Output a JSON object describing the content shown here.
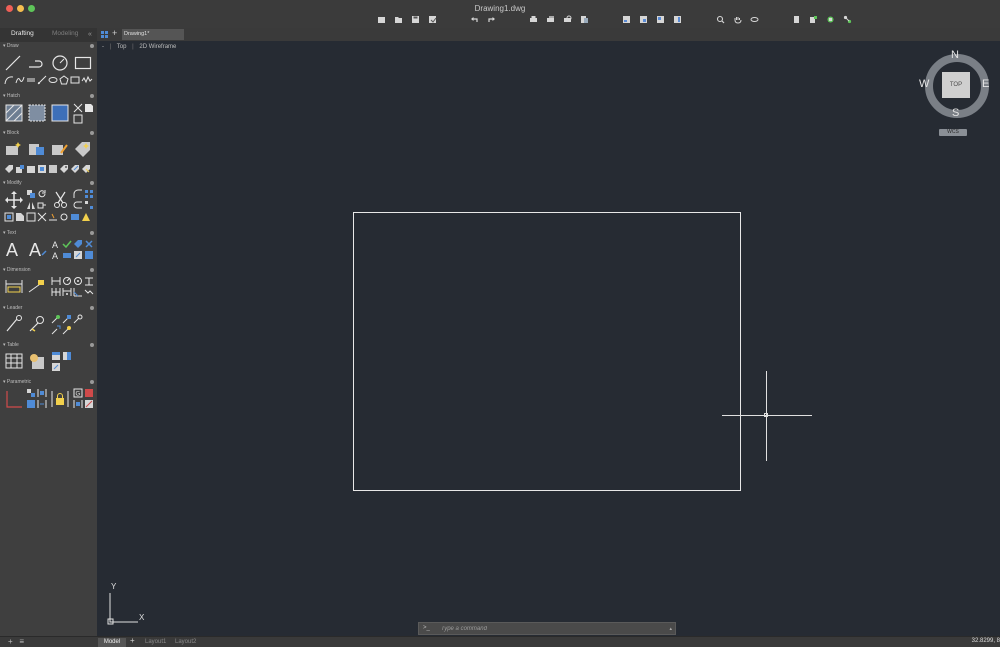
{
  "window": {
    "title": "Drawing1.dwg"
  },
  "toolbar": {
    "icons": [
      "new-icon",
      "open-icon",
      "save-icon",
      "save-as-icon",
      "undo-icon",
      "redo-icon",
      "plot-icon",
      "batch-plot-icon",
      "plot-preview-icon",
      "publish-icon",
      "sheet-icon",
      "layer-icon",
      "properties-icon",
      "layout-icon",
      "zoom-icon",
      "pan-icon",
      "orbit-icon",
      "file-icon",
      "attach-icon",
      "sync-icon",
      "share-icon"
    ]
  },
  "palette": {
    "tabs": {
      "drafting": "Drafting",
      "modeling": "Modeling"
    },
    "sections": {
      "draw": "Draw",
      "hatch": "Hatch",
      "block": "Block",
      "modify": "Modify",
      "text": "Text",
      "dimension": "Dimension",
      "leader": "Leader",
      "table": "Table",
      "parametric": "Parametric"
    }
  },
  "doc_tabs": {
    "active": "Drawing1*"
  },
  "viewport": {
    "controls": {
      "menu": "-",
      "view": "Top",
      "style": "2D Wireframe"
    },
    "navcube": {
      "n": "N",
      "s": "S",
      "e": "E",
      "w": "W",
      "face": "TOP",
      "wcs": "WCS"
    },
    "ucs": {
      "x": "X",
      "y": "Y"
    }
  },
  "command": {
    "prompt": ">_",
    "placeholder": "Type a command"
  },
  "status": {
    "layouts": {
      "model": "Model",
      "layout1": "Layout1",
      "layout2": "Layout2",
      "add": "+"
    },
    "coordinates": "32.8299, 8"
  },
  "colors": {
    "canvas": "#262b33",
    "palette": "#3f3f3f",
    "accent": "#3b82f6"
  }
}
